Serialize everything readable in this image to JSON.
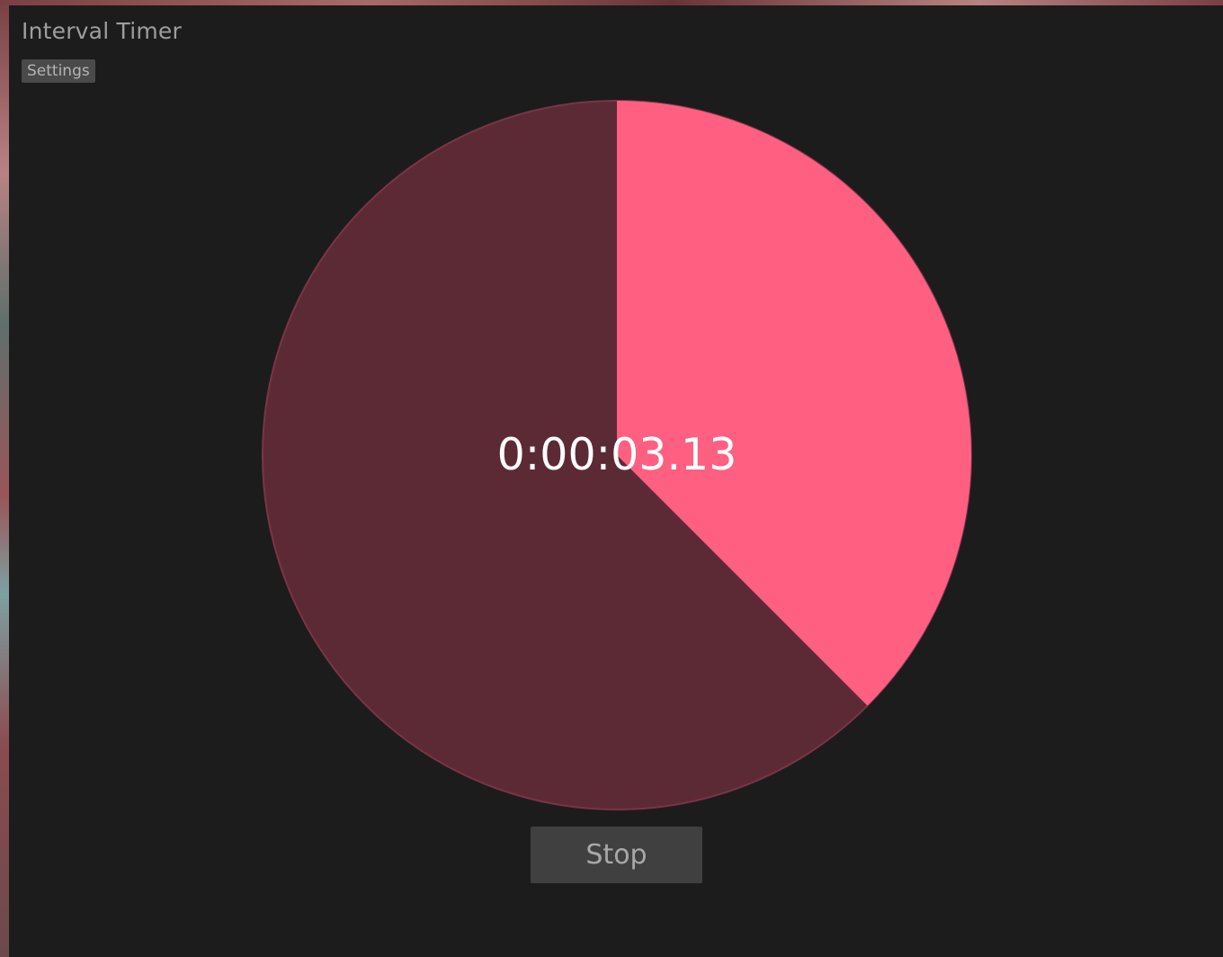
{
  "window": {
    "title": "Interval Timer"
  },
  "toolbar": {
    "settings_label": "Settings"
  },
  "timer": {
    "display": "0:00:03.13",
    "progress_fraction": 0.375,
    "elapsed_color": "#ff5f80",
    "remaining_color": "#5c2a35"
  },
  "controls": {
    "stop_label": "Stop"
  }
}
